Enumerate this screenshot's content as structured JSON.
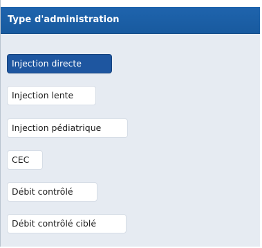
{
  "panel": {
    "title": "Type d'administration"
  },
  "options": [
    {
      "label": "Injection directe",
      "selected": true
    },
    {
      "label": "Injection lente",
      "selected": false
    },
    {
      "label": "Injection pédiatrique",
      "selected": false
    },
    {
      "label": "CEC",
      "selected": false
    },
    {
      "label": "Débit contrôlé",
      "selected": false
    },
    {
      "label": "Débit contrôlé ciblé",
      "selected": false
    }
  ],
  "colors": {
    "header_bg": "#1f64ad",
    "selected_bg": "#1e56a0",
    "panel_bg": "#e6ebf2"
  }
}
